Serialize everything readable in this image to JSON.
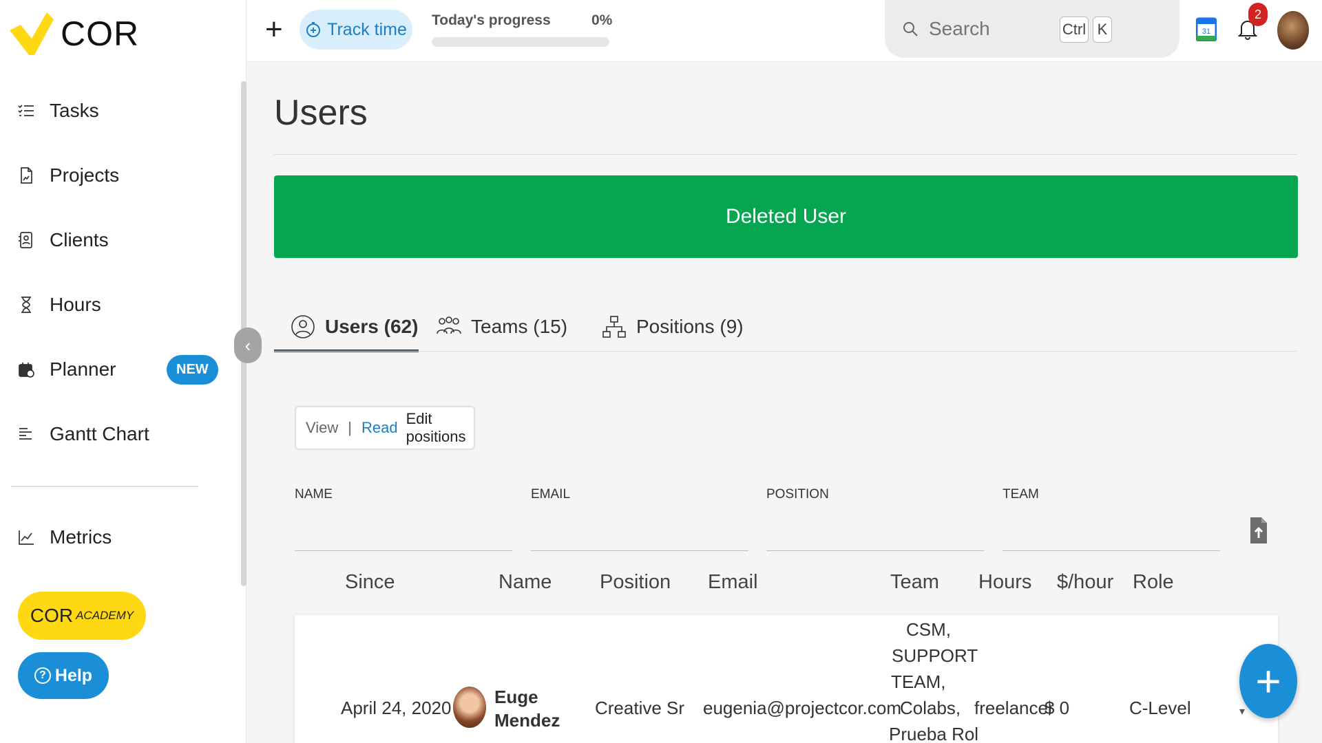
{
  "brand": {
    "name": "COR",
    "logo_color": "#ffd814"
  },
  "sidebar": {
    "items": [
      {
        "label": "Tasks",
        "icon": "tasks-list-icon"
      },
      {
        "label": "Projects",
        "icon": "project-doc-icon"
      },
      {
        "label": "Clients",
        "icon": "client-card-icon"
      },
      {
        "label": "Hours",
        "icon": "hourglass-icon"
      },
      {
        "label": "Planner",
        "icon": "planner-calendar-icon",
        "badge": "NEW"
      },
      {
        "label": "Gantt Chart",
        "icon": "gantt-icon"
      },
      {
        "label": "Metrics",
        "icon": "metrics-chart-icon"
      }
    ],
    "academy_main": "COR",
    "academy_sub": "ACADEMY",
    "help_label": "Help",
    "help_glyph": "?",
    "collapse_glyph": "‹"
  },
  "topbar": {
    "add_glyph": "+",
    "track_time_label": "Track time",
    "progress_label": "Today's progress",
    "progress_pct_text": "0%",
    "progress_value": 0,
    "search_placeholder": "Search",
    "shortcut_ctrl": "Ctrl",
    "shortcut_key": "K",
    "calendar_day": "31",
    "notifications_count": "2"
  },
  "page": {
    "title": "Users",
    "banner_text": "Deleted User",
    "banner_color": "#06a550",
    "tabs": [
      {
        "label": "Users (62)",
        "icon": "user-circle-icon",
        "active": true
      },
      {
        "label": "Teams (15)",
        "icon": "team-group-icon",
        "active": false
      },
      {
        "label": "Positions (9)",
        "icon": "org-chart-icon",
        "active": false
      }
    ],
    "view_toggle": {
      "view": "View",
      "separator": "|",
      "read": "Read",
      "edit": "Edit positions"
    },
    "filters": [
      "NAME",
      "EMAIL",
      "POSITION",
      "TEAM"
    ],
    "columns": [
      "Since",
      "Name",
      "Position",
      "Email",
      "Team",
      "Hours",
      "$/hour",
      "Role"
    ],
    "rows": [
      {
        "since": "April 24, 2020",
        "first_name": "Euge",
        "last_name": "Mendez",
        "position": "Creative Sr",
        "email": "eugenia@projectcor.com",
        "team_lines": [
          "CSM,",
          "SUPPORT",
          "TEAM,",
          "Colabs,",
          "Prueba Rol"
        ],
        "hours": "freelancer",
        "rate": "$ 0",
        "role": "C-Level"
      }
    ],
    "fab_glyph": "+",
    "row_menu_glyph": "▾"
  }
}
